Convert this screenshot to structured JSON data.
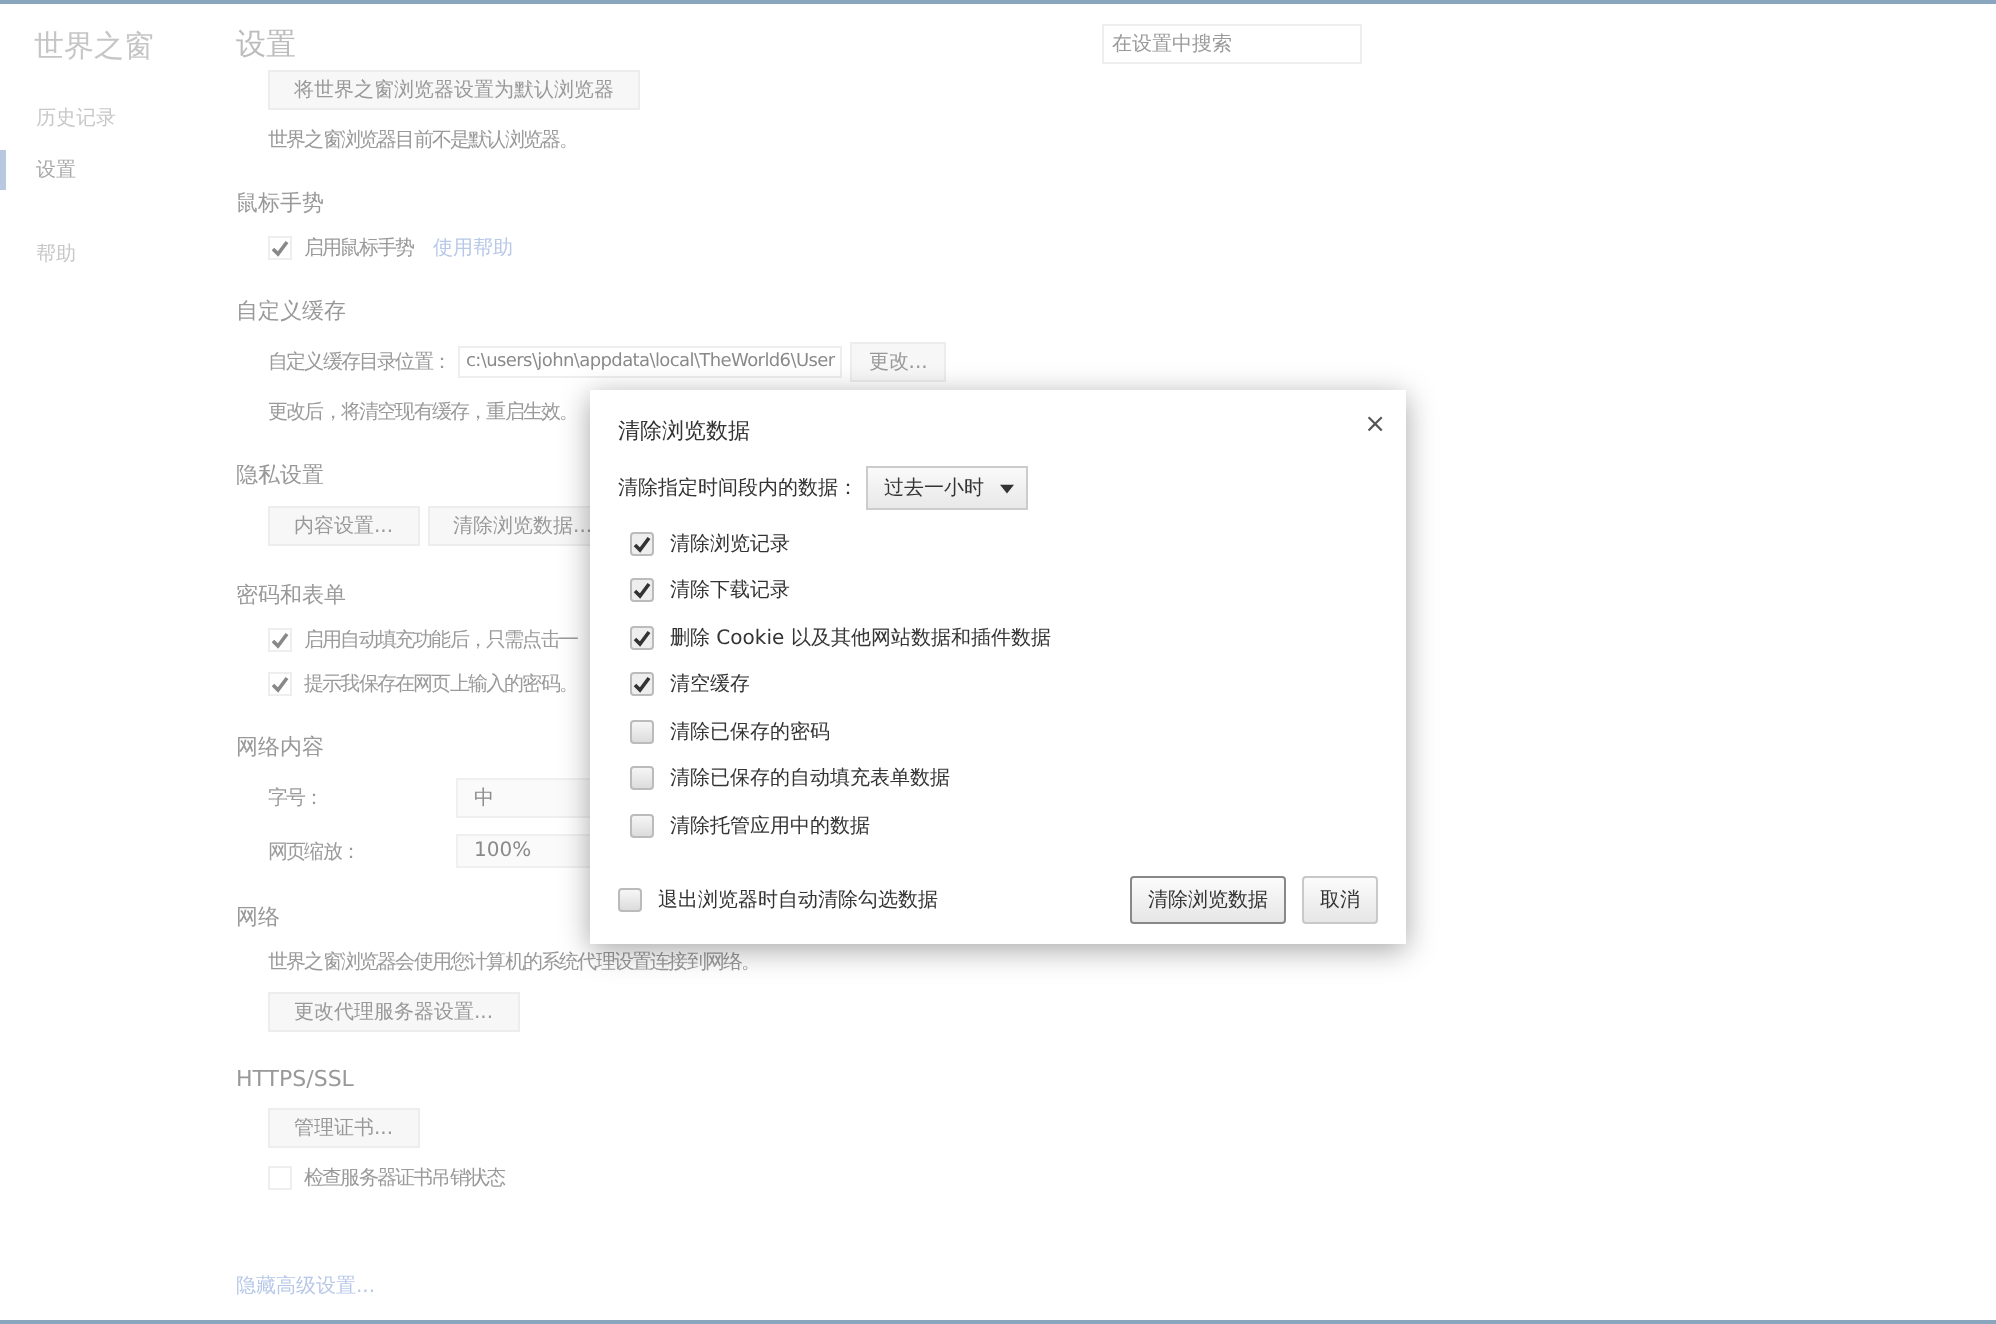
{
  "sidebar": {
    "title": "世界之窗",
    "items": [
      {
        "label": "历史记录",
        "selected": false
      },
      {
        "label": "设置",
        "selected": true
      },
      {
        "label": "帮助",
        "selected": false
      }
    ]
  },
  "header": {
    "title": "设置",
    "search": {
      "placeholder": "在设置中搜索"
    }
  },
  "sections": [
    {
      "rows": [
        {
          "kind": "button",
          "label": "将世界之窗浏览器设置为默认浏览器"
        },
        {
          "kind": "text",
          "text": "世界之窗浏览器目前不是默认浏览器。"
        }
      ]
    },
    {
      "title": "鼠标手势",
      "rows": [
        {
          "kind": "checkbox",
          "label": "启用鼠标手势",
          "checked": true,
          "link": "使用帮助"
        }
      ]
    },
    {
      "title": "自定义缓存",
      "rows": [
        {
          "kind": "field",
          "label": "自定义缓存目录位置：",
          "value": "c:\\users\\john\\appdata\\local\\TheWorld6\\User",
          "button": "更改..."
        },
        {
          "kind": "text",
          "text": "更改后，将清空现有缓存，重启生效。"
        }
      ]
    },
    {
      "title": "隐私设置",
      "rows": [
        {
          "kind": "buttons",
          "labels": [
            "内容设置...",
            "清除浏览数据..."
          ]
        }
      ]
    },
    {
      "title": "密码和表单",
      "rows": [
        {
          "kind": "checkbox",
          "label": "启用自动填充功能后，只需点击一",
          "checked": true
        },
        {
          "kind": "checkbox",
          "label": "提示我保存在网页上输入的密码。",
          "checked": true
        }
      ]
    },
    {
      "title": "网络内容",
      "rows": [
        {
          "kind": "select",
          "label": "字号：",
          "value": "中"
        },
        {
          "kind": "select",
          "label": "网页缩放：",
          "value": "100%"
        }
      ]
    },
    {
      "title": "网络",
      "rows": [
        {
          "kind": "text",
          "text": "世界之窗浏览器会使用您计算机的系统代理设置连接到网络。"
        },
        {
          "kind": "button",
          "label": "更改代理服务器设置..."
        }
      ]
    },
    {
      "title": "HTTPS/SSL",
      "rows": [
        {
          "kind": "button",
          "label": "管理证书..."
        },
        {
          "kind": "checkbox",
          "label": "检查服务器证书吊销状态",
          "checked": false
        }
      ]
    }
  ],
  "footer_link": "隐藏高级设置...",
  "dialog": {
    "title": "清除浏览数据",
    "close": "×",
    "range": {
      "label": "清除指定时间段内的数据：",
      "value": "过去一小时"
    },
    "options": [
      {
        "label": "清除浏览记录",
        "checked": true
      },
      {
        "label": "清除下载记录",
        "checked": true
      },
      {
        "label": "删除 Cookie 以及其他网站数据和插件数据",
        "checked": true
      },
      {
        "label": "清空缓存",
        "checked": true
      },
      {
        "label": "清除已保存的密码",
        "checked": false
      },
      {
        "label": "清除已保存的自动填充表单数据",
        "checked": false
      },
      {
        "label": "清除托管应用中的数据",
        "checked": false
      }
    ],
    "footer_option": {
      "label": "退出浏览器时自动清除勾选数据",
      "checked": false
    },
    "buttons": [
      "清除浏览数据",
      "取消"
    ]
  }
}
